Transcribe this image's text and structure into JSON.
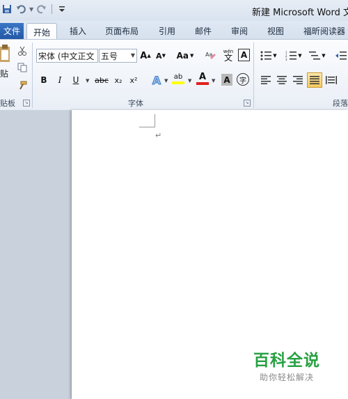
{
  "window": {
    "title": "新建 Microsoft Word 文档"
  },
  "qat": {
    "save_icon": "save-icon",
    "undo_icon": "undo-icon",
    "redo_icon": "redo-icon",
    "customize_icon": "customize-qat-icon"
  },
  "tabs": {
    "file": "文件",
    "items": [
      {
        "label": "开始",
        "active": true
      },
      {
        "label": "插入"
      },
      {
        "label": "页面布局"
      },
      {
        "label": "引用"
      },
      {
        "label": "邮件"
      },
      {
        "label": "审阅"
      },
      {
        "label": "视图"
      },
      {
        "label": "福昕阅读器"
      }
    ]
  },
  "clipboard": {
    "paste_label": "贴",
    "group_label": "贴板"
  },
  "font": {
    "name": "宋体 (中文正文",
    "size": "五号",
    "grow": "A",
    "shrink": "A",
    "case": "Aa",
    "bold": "B",
    "italic": "I",
    "underline": "U",
    "strike": "abc",
    "subscript": "x₂",
    "superscript": "x²",
    "text_effect": "A",
    "highlight": "ab",
    "font_color": "A",
    "char_shade": "A",
    "enclose": "字",
    "phonetic": "wén",
    "phonetic_sub": "文",
    "border_char": "A",
    "group_label": "字体"
  },
  "paragraph": {
    "group_label": "段落"
  },
  "document": {
    "para_mark": "↵"
  },
  "watermark": {
    "main": "百科全说",
    "sub": "助你轻松解决"
  },
  "colors": {
    "file_tab": "#2a62b0",
    "highlight_yellow": "#ffff00",
    "font_red": "#e0201c",
    "watermark_green": "#27a142"
  }
}
